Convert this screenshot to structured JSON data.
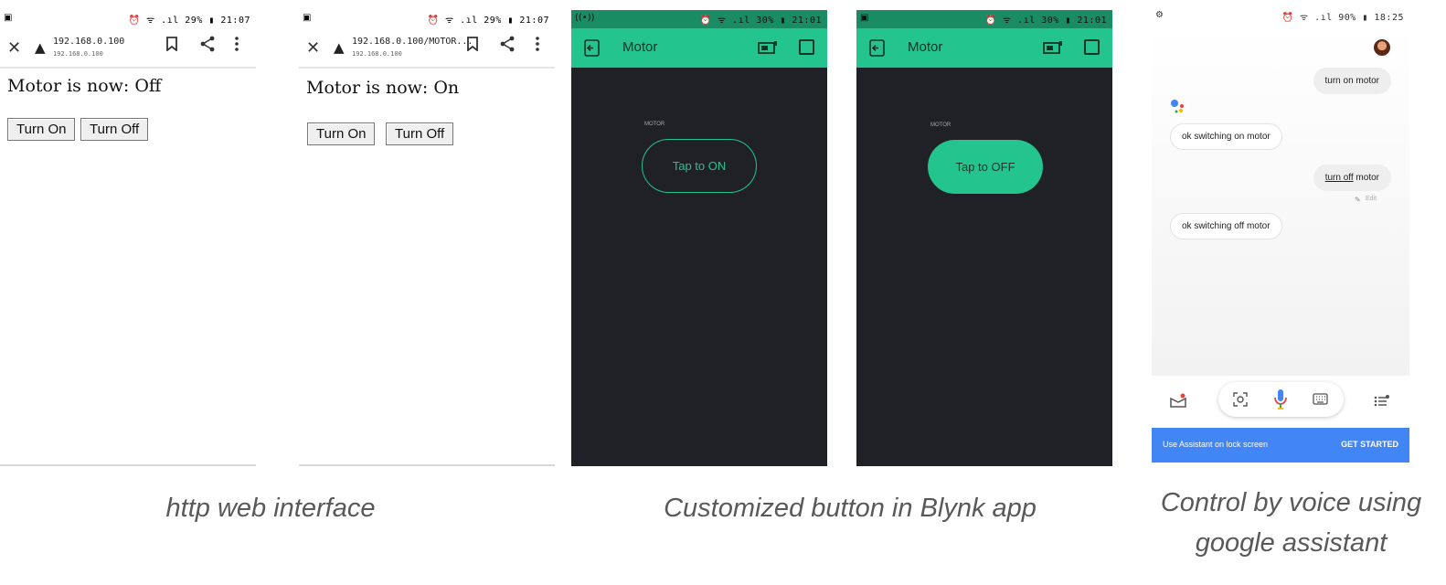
{
  "phone1": {
    "status_right": "⏰ ᯤ .ıl 29% ▮ 21:07",
    "url": "192.168.0.100",
    "url_sub": "192.168.0.100",
    "status_text": "Motor is now: Off",
    "turn_on": "Turn On",
    "turn_off": "Turn Off"
  },
  "phone2": {
    "status_right": "⏰ ᯤ .ıl 29% ▮ 21:07",
    "url": "192.168.0.100/MOTOR...",
    "url_sub": "192.168.0.100",
    "status_text": "Motor is now: On",
    "turn_on": "Turn On",
    "turn_off": "Turn Off"
  },
  "phone3": {
    "status_right": "⏰ ᯤ .ıl 30% ▮ 21:01",
    "title": "Motor",
    "widget_label": "MOTOR",
    "button_text": "Tap to ON"
  },
  "phone4": {
    "status_right": "⏰ ᯤ .ıl 30% ▮ 21:01",
    "title": "Motor",
    "widget_label": "MOTOR",
    "button_text": "Tap to OFF"
  },
  "phone5": {
    "status_right": "⏰ ᯤ .ıl 90% ▮ 18:25",
    "msg1": "turn on motor",
    "reply1": "ok switching on motor",
    "msg2_underlined": "turn off",
    "msg2_rest": " motor",
    "edit_label": "Edit",
    "reply2": "ok switching off motor",
    "banner_text": "Use Assistant on lock screen",
    "banner_cta": "GET STARTED"
  },
  "captions": {
    "web": "http web interface",
    "blynk": "Customized button in Blynk app",
    "assistant_line1": "Control by voice using",
    "assistant_line2": "google assistant"
  },
  "colors": {
    "blynk_green": "#23c48e",
    "blynk_bg": "#1f2126",
    "assistant_blue": "#4285f4"
  }
}
